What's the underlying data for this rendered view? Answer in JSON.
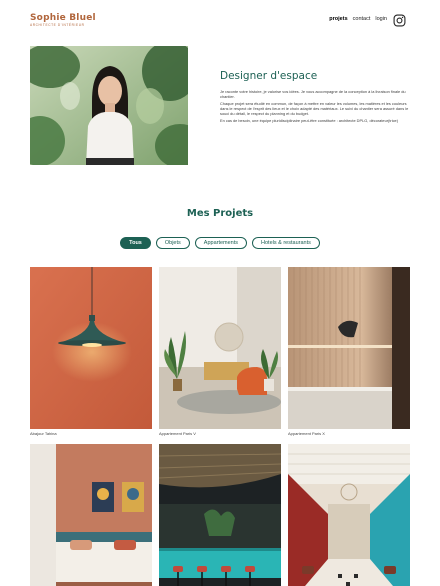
{
  "header": {
    "logo_title": "Sophie Bluel",
    "logo_subtitle": "Architecte d'intérieur",
    "nav": [
      "projets",
      "contact",
      "login"
    ],
    "instagram_icon": "instagram-icon"
  },
  "intro": {
    "title": "Designer d'espace",
    "paragraphs": [
      "Je raconte votre histoire, je valorise vos idées. Je vous accompagne de la conception à la livraison finale du chantier.",
      "Chaque projet sera étudié en commun, de façon à mettre en valeur les volumes, les matières et les couleurs dans le respect de l'esprit des lieux et le choix adapté des matériaux. Le suivi du chantier sera assuré dans le souci du détail, le respect du planning et du budget.",
      "En cas de besoin, une équipe pluridisciplinaire peut-être constituée : architecte DPLG, décorateur(trice)"
    ]
  },
  "projects": {
    "title": "Mes Projets",
    "filters": [
      "Tous",
      "Objets",
      "Appartements",
      "Hotels & restaurants"
    ],
    "active_filter": "Tous",
    "items": [
      {
        "caption": "Abajour Tahina"
      },
      {
        "caption": "Appartement Paris V"
      },
      {
        "caption": "Appartement Paris X"
      },
      {
        "caption": ""
      },
      {
        "caption": ""
      },
      {
        "caption": ""
      }
    ]
  },
  "colors": {
    "accent": "#1d6154",
    "brand": "#b1663c"
  }
}
